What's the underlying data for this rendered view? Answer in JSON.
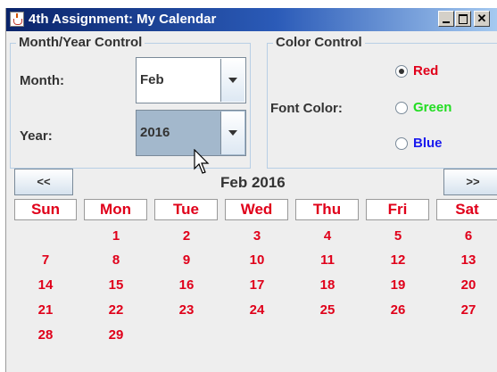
{
  "window": {
    "title": "4th Assignment: My Calendar"
  },
  "month_year_panel": {
    "title": "Month/Year Control",
    "month_label": "Month:",
    "month_value": "Feb",
    "year_label": "Year:",
    "year_value": "2016"
  },
  "color_panel": {
    "title": "Color Control",
    "font_color_label": "Font Color:",
    "options": [
      {
        "label": "Red",
        "color": "#e0001a",
        "checked": true
      },
      {
        "label": "Green",
        "color": "#22dd22",
        "checked": false
      },
      {
        "label": "Blue",
        "color": "#1a1aee",
        "checked": false
      }
    ]
  },
  "calendar": {
    "prev_label": "<<",
    "next_label": ">>",
    "month_label": "Feb 2016",
    "day_names": [
      "Sun",
      "Mon",
      "Tue",
      "Wed",
      "Thu",
      "Fri",
      "Sat"
    ],
    "weeks": [
      [
        "",
        "1",
        "2",
        "3",
        "4",
        "5",
        "6"
      ],
      [
        "7",
        "8",
        "9",
        "10",
        "11",
        "12",
        "13"
      ],
      [
        "14",
        "15",
        "16",
        "17",
        "18",
        "19",
        "20"
      ],
      [
        "21",
        "22",
        "23",
        "24",
        "25",
        "26",
        "27"
      ],
      [
        "28",
        "29",
        "",
        "",
        "",
        "",
        ""
      ]
    ]
  }
}
